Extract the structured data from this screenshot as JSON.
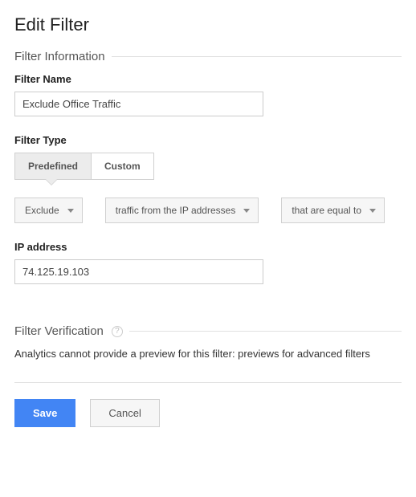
{
  "page_title": "Edit Filter",
  "sections": {
    "info_title": "Filter Information",
    "verification_title": "Filter Verification"
  },
  "fields": {
    "filter_name_label": "Filter Name",
    "filter_name_value": "Exclude Office Traffic",
    "filter_type_label": "Filter Type",
    "ip_address_label": "IP address",
    "ip_address_value": "74.125.19.103"
  },
  "filter_type": {
    "predefined_label": "Predefined",
    "custom_label": "Custom"
  },
  "dropdowns": {
    "action": "Exclude",
    "source": "traffic from the IP addresses",
    "expression": "that are equal to"
  },
  "verification_message": "Analytics cannot provide a preview for this filter: previews for advanced filters",
  "buttons": {
    "save": "Save",
    "cancel": "Cancel"
  }
}
